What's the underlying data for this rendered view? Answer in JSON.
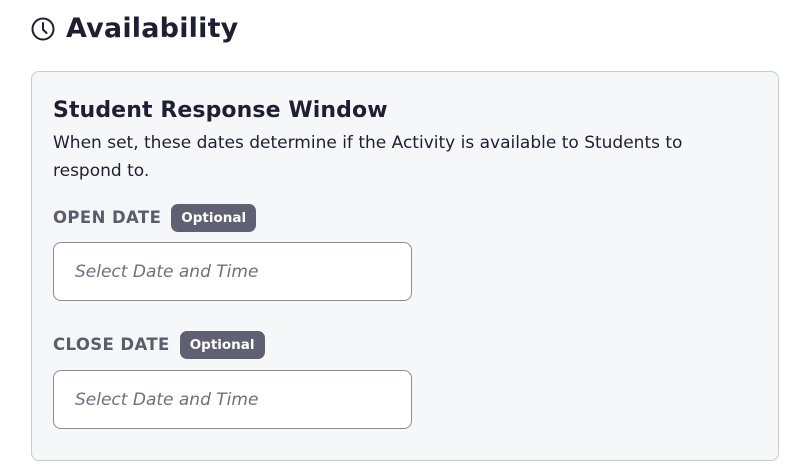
{
  "header": {
    "icon": "clock-icon",
    "title": "Availability"
  },
  "card": {
    "title": "Student Response Window",
    "description": "When set, these dates determine if the Activity is available to Students to respond to."
  },
  "fields": {
    "open_date": {
      "label": "OPEN DATE",
      "badge": "Optional",
      "placeholder": "Select Date and Time",
      "value": ""
    },
    "close_date": {
      "label": "CLOSE DATE",
      "badge": "Optional",
      "placeholder": "Select Date and Time",
      "value": ""
    }
  },
  "colors": {
    "badge_bg": "#5f6173",
    "card_bg": "#f6f7f9",
    "text_primary": "#1e1f33",
    "label_color": "#5a5d6c"
  }
}
